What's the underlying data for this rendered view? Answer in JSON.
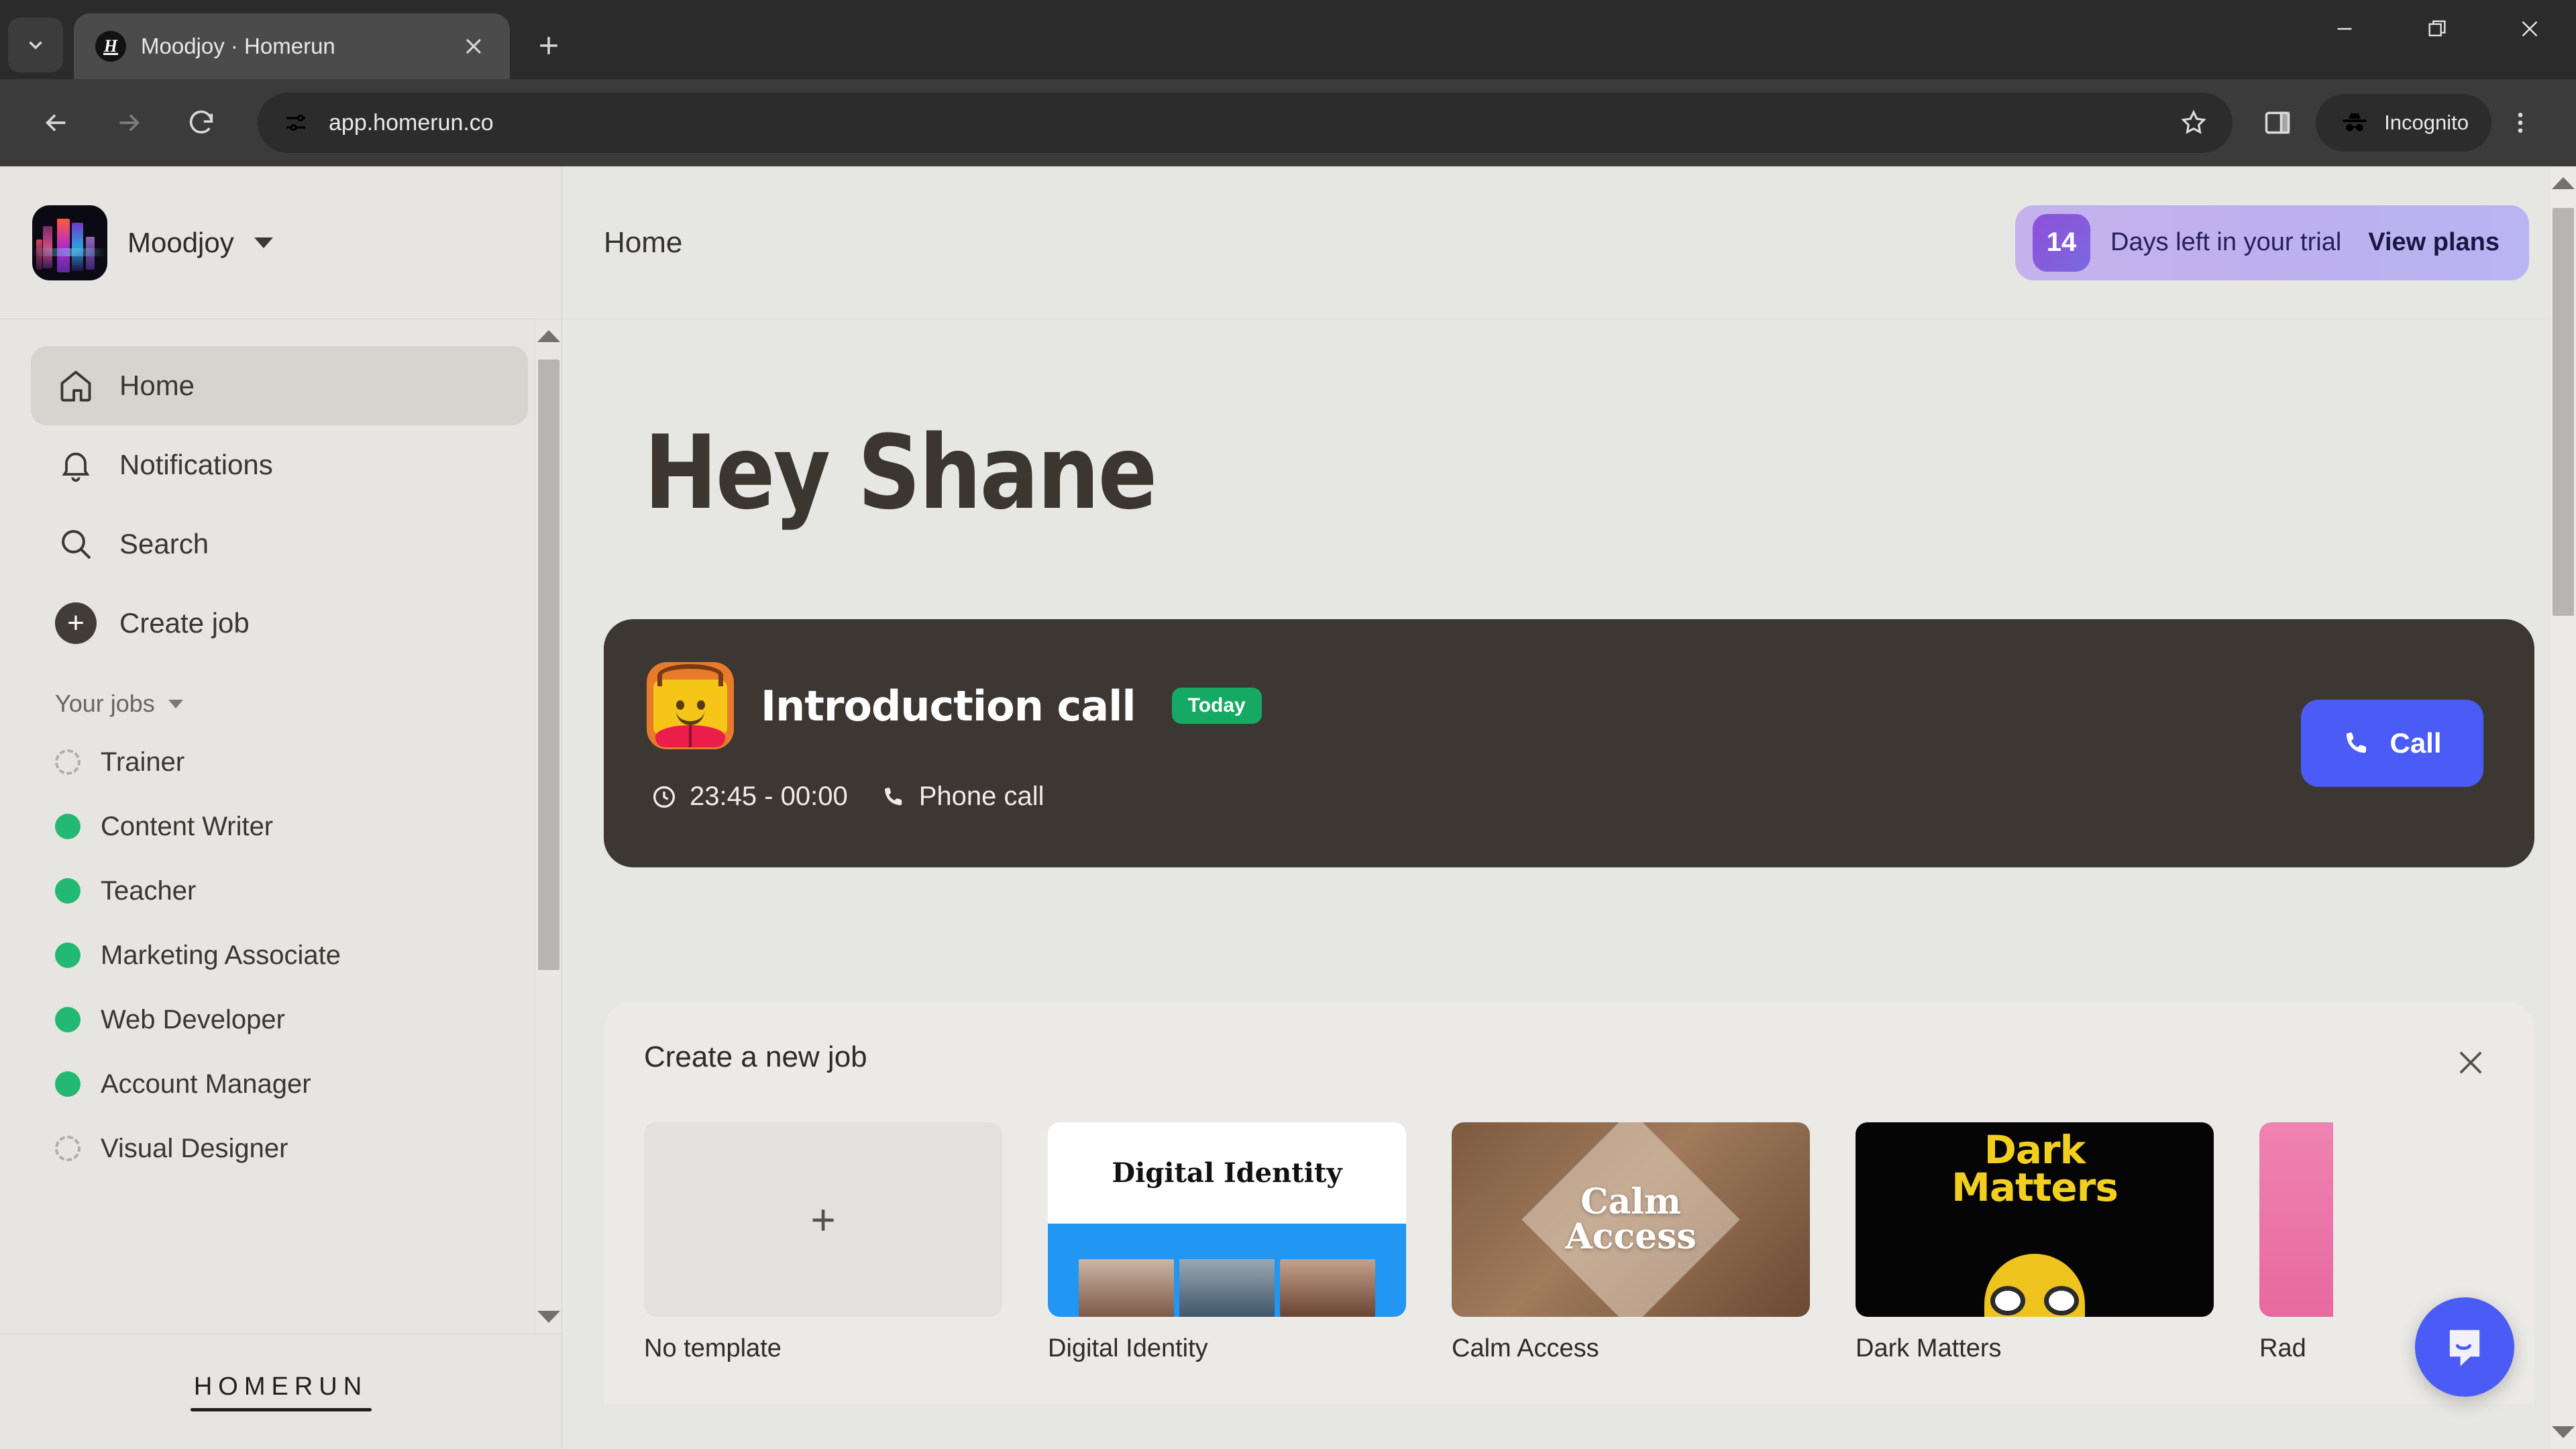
{
  "browser": {
    "tab": {
      "title": "Moodjoy · Homerun",
      "favicon_letter": "H"
    },
    "tab_list_icon": "chevron-down-icon",
    "new_tab_label": "+",
    "close_tab_label": "×",
    "window": {
      "minimize": "—",
      "restore": "❐",
      "close": "✕"
    },
    "nav": {
      "back": "←",
      "forward": "→",
      "reload": "⟳"
    },
    "omnibox": {
      "url": "app.homerun.co",
      "site_info_icon": "page-settings-icon"
    },
    "bookmark_icon": "star-icon",
    "side_panel_icon": "side-panel-icon",
    "profile": {
      "label": "Incognito",
      "icon": "incognito-icon"
    },
    "menu_icon": "three-dot-menu-icon"
  },
  "sidebar": {
    "org": {
      "name": "Moodjoy",
      "avatar": "city-night-photo",
      "caret": "chevron-down-icon"
    },
    "nav": [
      {
        "label": "Home",
        "icon": "home-icon",
        "active": true
      },
      {
        "label": "Notifications",
        "icon": "bell-icon",
        "active": false
      },
      {
        "label": "Search",
        "icon": "search-icon",
        "active": false
      },
      {
        "label": "Create job",
        "icon": "plus-circle-icon",
        "active": false
      }
    ],
    "jobs_section": {
      "title": "Your jobs",
      "caret": "chevron-down-icon"
    },
    "jobs": [
      {
        "label": "Trainer",
        "status": "draft"
      },
      {
        "label": "Content Writer",
        "status": "live"
      },
      {
        "label": "Teacher",
        "status": "live"
      },
      {
        "label": "Marketing Associate",
        "status": "live"
      },
      {
        "label": "Web Developer",
        "status": "live"
      },
      {
        "label": "Account Manager",
        "status": "live"
      },
      {
        "label": "Visual Designer",
        "status": "draft"
      }
    ],
    "footer_logo": "HOMERUN"
  },
  "topbar": {
    "breadcrumb": "Home",
    "trial": {
      "days": "14",
      "text": "Days left in your trial",
      "cta": "View plans"
    }
  },
  "main": {
    "greeting": "Hey Shane",
    "event": {
      "title": "Introduction call",
      "badge": "Today",
      "time": "23:45 - 00:00",
      "type": "Phone call",
      "time_icon": "clock-icon",
      "type_icon": "phone-icon",
      "action": {
        "label": "Call",
        "icon": "phone-icon",
        "color": "#4a5cf5"
      },
      "avatar": "person-illustration"
    },
    "templates_panel": {
      "title": "Create a new job",
      "close_icon": "close-icon",
      "items": [
        {
          "label": "No template",
          "art": "plus",
          "plus": "+"
        },
        {
          "label": "Digital Identity",
          "art": "digital-identity",
          "art_text": "Digital Identity"
        },
        {
          "label": "Calm Access",
          "art": "calm-access",
          "art_line1": "Calm",
          "art_line2": "Access"
        },
        {
          "label": "Dark Matters",
          "art": "dark-matters",
          "art_line1": "Dark",
          "art_line2": "Matters"
        },
        {
          "label": "Rad",
          "art": "radiant-pink",
          "clipped": true
        }
      ]
    }
  },
  "widgets": {
    "intercom": {
      "icon": "chat-bubble-icon",
      "color": "#4a5cf5"
    }
  },
  "colors": {
    "accent_blue": "#4a5cf5",
    "status_green": "#23b873",
    "badge_green": "#16a963",
    "trial_purple": "#8f4fd8",
    "card_dark": "#3d3733",
    "app_bg": "#e6e6e3",
    "sidebar_bg": "#e6e5e1"
  }
}
